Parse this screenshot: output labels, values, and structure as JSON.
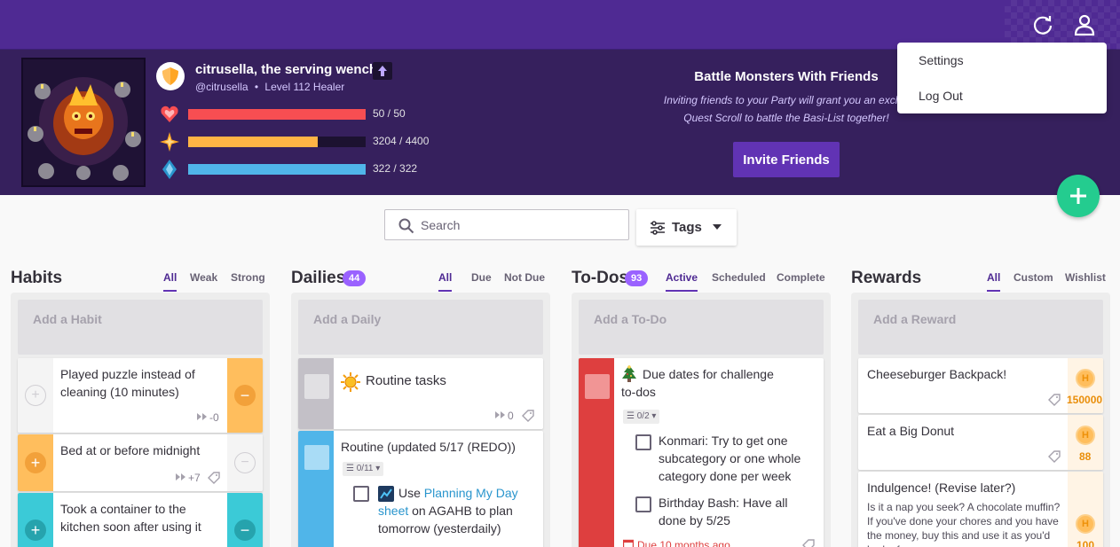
{
  "user_menu": {
    "items": [
      "Settings",
      "Log Out"
    ]
  },
  "hero": {
    "name": "citrusella, the serving wench",
    "handle": "@citrusella",
    "level": "Level 112 Healer",
    "health": {
      "label": "50 / 50",
      "fraction": 1.0,
      "color": "#f74e52"
    },
    "experience": {
      "label": "3204 / 4400",
      "fraction": 0.728,
      "color": "#ffb445"
    },
    "mana": {
      "label": "322 / 322",
      "fraction": 1.0,
      "color": "#50b5e9"
    }
  },
  "party": {
    "title": "Battle Monsters With Friends",
    "line1": "Inviting friends to your Party will grant you an exclus",
    "line2": "Quest Scroll to battle the Basi-List together!",
    "invite_label": "Invite Friends"
  },
  "search": {
    "placeholder": "Search"
  },
  "tags": {
    "label": "Tags"
  },
  "habits": {
    "title": "Habits",
    "tabs": [
      "All",
      "Weak",
      "Strong"
    ],
    "add_label": "Add a Habit",
    "items": [
      {
        "text": "Played puzzle instead of cleaning (10 minutes)",
        "streak": "-0"
      },
      {
        "text": "Bed at or before midnight",
        "streak": "+7"
      },
      {
        "text": "Took a container to the kitchen soon after using it"
      }
    ]
  },
  "dailies": {
    "title": "Dailies",
    "count": "44",
    "tabs": [
      "All",
      "Due",
      "Not Due"
    ],
    "add_label": "Add a Daily",
    "items": [
      {
        "text": "Routine tasks",
        "streak": "0"
      },
      {
        "text": "Routine (updated 5/17 (REDO))",
        "checklist": "0/11",
        "sub": {
          "prefix": "Use ",
          "link": "Planning My Day sheet",
          "rest": " on AGAHB to plan tomorrow (yesterdaily)"
        }
      }
    ]
  },
  "todos": {
    "title": "To-Dos",
    "count": "93",
    "tabs": [
      "Active",
      "Scheduled",
      "Complete"
    ],
    "add_label": "Add a To-Do",
    "items": [
      {
        "text": "Due dates for challenge to-dos",
        "checklist": "0/2",
        "sub": [
          "Konmari: Try to get one subcategory or one whole category done per week",
          "Birthday Bash: Have all done by 5/25"
        ],
        "due": "Due 10 months ago"
      }
    ]
  },
  "rewards": {
    "title": "Rewards",
    "tabs": [
      "All",
      "Custom",
      "Wishlist"
    ],
    "add_label": "Add a Reward",
    "items": [
      {
        "text": "Cheeseburger Backpack!",
        "price": "150000"
      },
      {
        "text": "Eat a Big Donut",
        "price": "88"
      },
      {
        "text": "Indulgence! (Revise later?)",
        "notes": "Is it a nap you seek? A chocolate muffin? If you've done your chores and you have the money, buy this and use it as you'd had a free",
        "price": "100"
      }
    ]
  }
}
